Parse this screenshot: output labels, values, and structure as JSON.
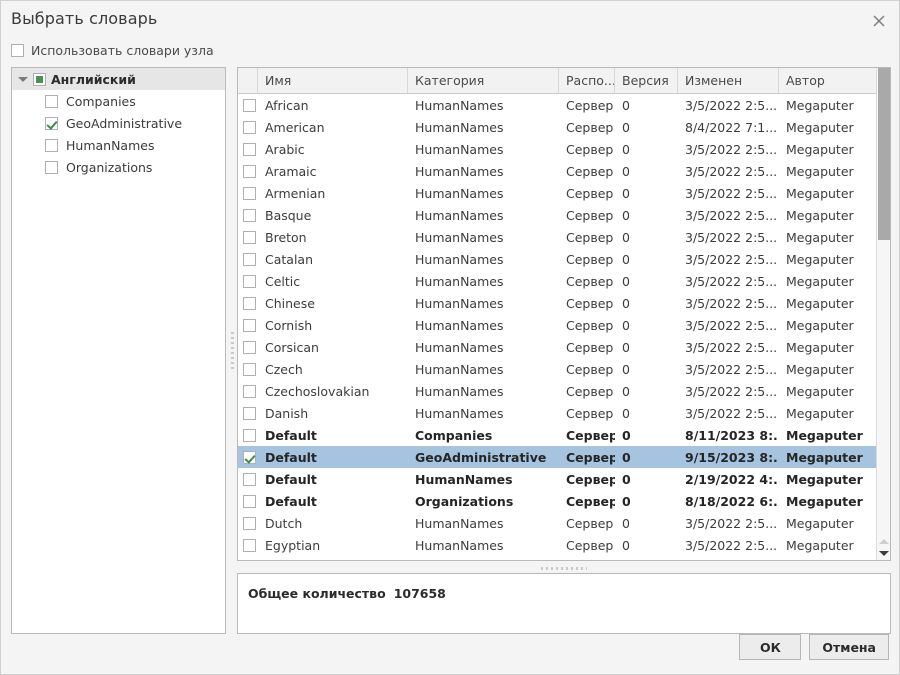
{
  "dialog": {
    "title": "Выбрать словарь",
    "close_icon": "close-icon"
  },
  "node_dicts": {
    "label": "Использовать словари узла",
    "checked": false
  },
  "tree": {
    "root": {
      "label": "Английский",
      "state": "partial"
    },
    "children": [
      {
        "label": "Companies",
        "checked": false
      },
      {
        "label": "GeoAdministrative",
        "checked": true
      },
      {
        "label": "HumanNames",
        "checked": false
      },
      {
        "label": "Organizations",
        "checked": false
      }
    ]
  },
  "table": {
    "columns": [
      "Имя",
      "Категория",
      "Распо...",
      "Версия",
      "Изменен",
      "Автор"
    ],
    "rows": [
      {
        "checked": false,
        "bold": false,
        "name": "African",
        "category": "HumanNames",
        "location": "Сервер",
        "version": "0",
        "modified": "3/5/2022 2:5...",
        "author": "Megaputer"
      },
      {
        "checked": false,
        "bold": false,
        "name": "American",
        "category": "HumanNames",
        "location": "Сервер",
        "version": "0",
        "modified": "8/4/2022 7:1...",
        "author": "Megaputer"
      },
      {
        "checked": false,
        "bold": false,
        "name": "Arabic",
        "category": "HumanNames",
        "location": "Сервер",
        "version": "0",
        "modified": "3/5/2022 2:5...",
        "author": "Megaputer"
      },
      {
        "checked": false,
        "bold": false,
        "name": "Aramaic",
        "category": "HumanNames",
        "location": "Сервер",
        "version": "0",
        "modified": "3/5/2022 2:5...",
        "author": "Megaputer"
      },
      {
        "checked": false,
        "bold": false,
        "name": "Armenian",
        "category": "HumanNames",
        "location": "Сервер",
        "version": "0",
        "modified": "3/5/2022 2:5...",
        "author": "Megaputer"
      },
      {
        "checked": false,
        "bold": false,
        "name": "Basque",
        "category": "HumanNames",
        "location": "Сервер",
        "version": "0",
        "modified": "3/5/2022 2:5...",
        "author": "Megaputer"
      },
      {
        "checked": false,
        "bold": false,
        "name": "Breton",
        "category": "HumanNames",
        "location": "Сервер",
        "version": "0",
        "modified": "3/5/2022 2:5...",
        "author": "Megaputer"
      },
      {
        "checked": false,
        "bold": false,
        "name": "Catalan",
        "category": "HumanNames",
        "location": "Сервер",
        "version": "0",
        "modified": "3/5/2022 2:5...",
        "author": "Megaputer"
      },
      {
        "checked": false,
        "bold": false,
        "name": "Celtic",
        "category": "HumanNames",
        "location": "Сервер",
        "version": "0",
        "modified": "3/5/2022 2:5...",
        "author": "Megaputer"
      },
      {
        "checked": false,
        "bold": false,
        "name": "Chinese",
        "category": "HumanNames",
        "location": "Сервер",
        "version": "0",
        "modified": "3/5/2022 2:5...",
        "author": "Megaputer"
      },
      {
        "checked": false,
        "bold": false,
        "name": "Cornish",
        "category": "HumanNames",
        "location": "Сервер",
        "version": "0",
        "modified": "3/5/2022 2:5...",
        "author": "Megaputer"
      },
      {
        "checked": false,
        "bold": false,
        "name": "Corsican",
        "category": "HumanNames",
        "location": "Сервер",
        "version": "0",
        "modified": "3/5/2022 2:5...",
        "author": "Megaputer"
      },
      {
        "checked": false,
        "bold": false,
        "name": "Czech",
        "category": "HumanNames",
        "location": "Сервер",
        "version": "0",
        "modified": "3/5/2022 2:5...",
        "author": "Megaputer"
      },
      {
        "checked": false,
        "bold": false,
        "name": "Czechoslovakian",
        "category": "HumanNames",
        "location": "Сервер",
        "version": "0",
        "modified": "3/5/2022 2:5...",
        "author": "Megaputer"
      },
      {
        "checked": false,
        "bold": false,
        "name": "Danish",
        "category": "HumanNames",
        "location": "Сервер",
        "version": "0",
        "modified": "3/5/2022 2:5...",
        "author": "Megaputer"
      },
      {
        "checked": false,
        "bold": true,
        "name": "Default",
        "category": "Companies",
        "location": "Сервер",
        "version": "0",
        "modified": "8/11/2023 8:...",
        "author": "Megaputer"
      },
      {
        "checked": true,
        "bold": true,
        "selected": true,
        "name": "Default",
        "category": "GeoAdministrative",
        "location": "Сервер",
        "version": "0",
        "modified": "9/15/2023 8:...",
        "author": "Megaputer"
      },
      {
        "checked": false,
        "bold": true,
        "name": "Default",
        "category": "HumanNames",
        "location": "Сервер",
        "version": "0",
        "modified": "2/19/2022 4:...",
        "author": "Megaputer"
      },
      {
        "checked": false,
        "bold": true,
        "name": "Default",
        "category": "Organizations",
        "location": "Сервер",
        "version": "0",
        "modified": "8/18/2022 6:...",
        "author": "Megaputer"
      },
      {
        "checked": false,
        "bold": false,
        "name": "Dutch",
        "category": "HumanNames",
        "location": "Сервер",
        "version": "0",
        "modified": "3/5/2022 2:5...",
        "author": "Megaputer"
      },
      {
        "checked": false,
        "bold": false,
        "name": "Egyptian",
        "category": "HumanNames",
        "location": "Сервер",
        "version": "0",
        "modified": "3/5/2022 2:5...",
        "author": "Megaputer"
      }
    ]
  },
  "summary": {
    "label": "Общее количество",
    "count": "107658"
  },
  "footer": {
    "ok_label": "ОК",
    "cancel_label": "Отмена"
  },
  "colors": {
    "selection": "#a6c4e0",
    "check_green": "#3d8b45",
    "panel_bg": "#f4f4f4"
  }
}
